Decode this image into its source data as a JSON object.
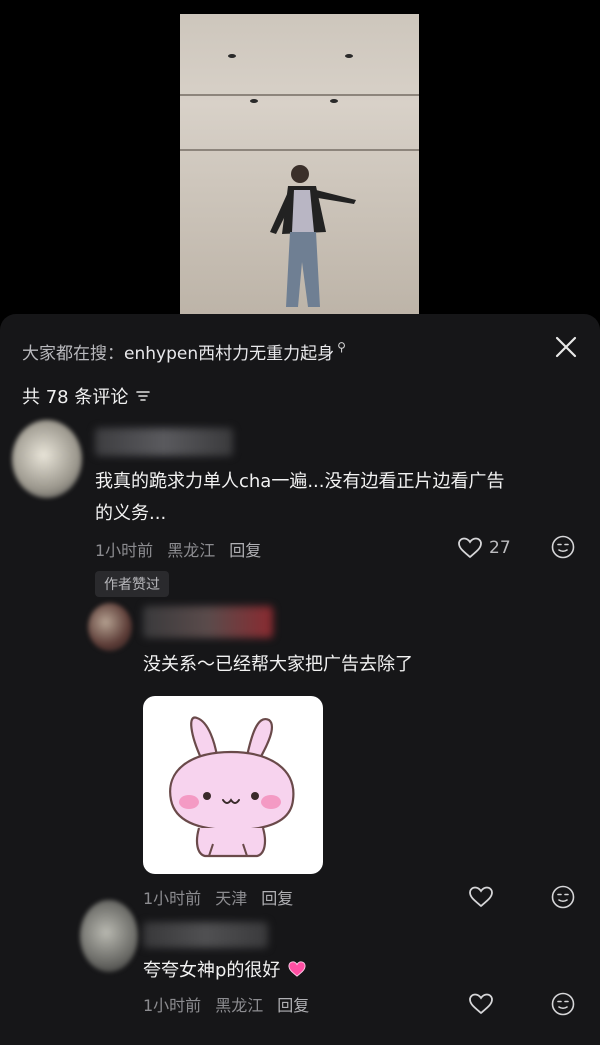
{
  "search": {
    "prefix": "大家都在搜：",
    "query": "enhypen西村力无重力起身"
  },
  "comments_header": {
    "label": "共 78 条评论"
  },
  "comments": [
    {
      "text_line1": "我真的跪求力单人cha一遍...没有边看正片边看广告",
      "text_line2": "的义务...",
      "time": "1小时前",
      "location": "黑龙江",
      "reply_label": "回复",
      "likes": "27",
      "author_tag": "作者赞过"
    },
    {
      "text": "没关系～已经帮大家把广告去除了",
      "time": "1小时前",
      "location": "天津",
      "reply_label": "回复"
    },
    {
      "text": "夸夸女神p的很好",
      "time": "1小时前",
      "location": "黑龙江",
      "reply_label": "回复"
    }
  ],
  "colors": {
    "sheet_bg": "#161618",
    "heart_emoji": "#ff4fa3"
  }
}
